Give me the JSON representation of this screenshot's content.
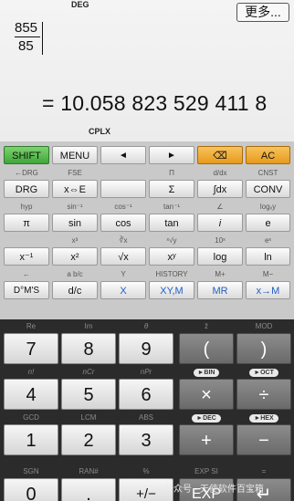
{
  "display": {
    "mode": "DEG",
    "more_label": "更多...",
    "numerator": "855",
    "denominator": "85",
    "result": "= 10.058 823 529 411 8",
    "complex_indicator": "CPLX"
  },
  "row1": {
    "shift": "SHIFT",
    "menu": "MENU",
    "left": "◄",
    "right": "►",
    "del": "⌫",
    "ac": "AC"
  },
  "row2_sub": {
    "drg_back": "←DRG",
    "fse": "FSE",
    "pi_prod": "Π",
    "ddx": "d/dx",
    "cnst": "CNST"
  },
  "row2": {
    "drg": "DRG",
    "xe": "x⇔E",
    "blank": "",
    "sigma": "Σ",
    "integral": "∫dx",
    "conv": "CONV"
  },
  "row3_sub": {
    "hyp": "hyp",
    "asin": "sin⁻¹",
    "acos": "cos⁻¹",
    "atan": "tan⁻¹",
    "angle": "∠",
    "logxy": "logₓy"
  },
  "row3": {
    "pi": "π",
    "sin": "sin",
    "cos": "cos",
    "tan": "tan",
    "i": "i",
    "e": "e"
  },
  "row4_sub": {
    "cube": "x³",
    "cbrt": "∛x",
    "xroot": "ˣ√y",
    "tenx": "10ˣ",
    "ex": "eˣ"
  },
  "row4": {
    "inv": "x⁻¹",
    "sq": "x²",
    "sqrt": "√x",
    "pow": "xʸ",
    "log": "log",
    "ln": "ln"
  },
  "row5_sub": {
    "back": "←",
    "abc": "a b/c",
    "y": "Y",
    "history": "HISTORY",
    "mplus": "M+",
    "mminus": "M−"
  },
  "row5": {
    "dms": "D°M'S",
    "dc": "d/c",
    "x": "X",
    "xym": "XY,M",
    "mr": "MR",
    "xm": "x→M"
  },
  "num_sub1": {
    "re": "Re",
    "im": "Im",
    "theta": "θ",
    "conj": "z̄",
    "mod": "MOD"
  },
  "num_row1": {
    "seven": "7",
    "eight": "8",
    "nine": "9",
    "lparen": "(",
    "rparen": ")"
  },
  "num_sub2": {
    "fact": "n!",
    "ncr": "nCr",
    "npr": "nPr",
    "bin": "►BIN",
    "oct": "►OCT"
  },
  "num_row2": {
    "four": "4",
    "five": "5",
    "six": "6",
    "mul": "×",
    "div": "÷"
  },
  "num_sub3": {
    "gcd": "GCD",
    "lcm": "LCM",
    "abs": "ABS",
    "dec": "►DEC",
    "hex": "►HEX"
  },
  "num_row3": {
    "one": "1",
    "two": "2",
    "three": "3",
    "plus": "+",
    "minus": "−"
  },
  "num_sub4": {
    "sgn": "SGN",
    "rand": "RAN#",
    "pct": "%",
    "expsi": "EXP SI",
    "eq": "="
  },
  "num_row4": {
    "zero": "0",
    "dot": ".",
    "neg": "+/−",
    "exp": "EXP",
    "enter": "↵"
  },
  "watermark": "公众号 · 天使软件百宝箱"
}
